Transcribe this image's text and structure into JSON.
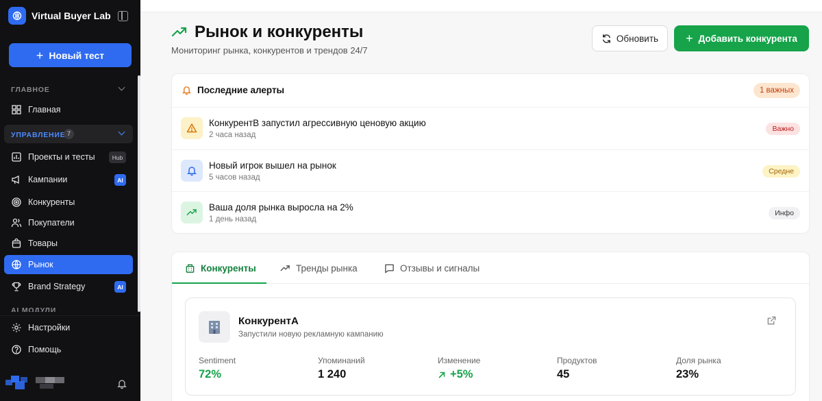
{
  "sidebar": {
    "brand": "Virtual Buyer Lab",
    "new_test": "Новый тест",
    "section_main": "ГЛАВНОЕ",
    "section_manage": "УПРАВЛЕНИЕ",
    "manage_count": "7",
    "section_ai": "AI МОДУЛИ",
    "items": [
      {
        "label": "Главная",
        "icon": "grid-icon"
      },
      {
        "label": "Проекты и тесты",
        "icon": "chart-icon",
        "tag": "Hub"
      },
      {
        "label": "Кампании",
        "icon": "megaphone-icon",
        "tag": "AI"
      },
      {
        "label": "Конкуренты",
        "icon": "target-icon"
      },
      {
        "label": "Покупатели",
        "icon": "users-icon"
      },
      {
        "label": "Товары",
        "icon": "bag-icon"
      },
      {
        "label": "Рынок",
        "icon": "globe-icon",
        "active": true
      },
      {
        "label": "Brand Strategy",
        "icon": "trophy-icon",
        "tag": "AI"
      }
    ],
    "settings": "Настройки",
    "help": "Помощь"
  },
  "header": {
    "title": "Рынок и конкуренты",
    "subtitle": "Мониторинг рынка, конкурентов и трендов 24/7",
    "refresh": "Обновить",
    "add": "Добавить конкурента"
  },
  "alerts": {
    "title": "Последние алерты",
    "important": "1 важных",
    "items": [
      {
        "title": "КонкурентВ запустил агрессивную ценовую акцию",
        "time": "2 часа назад",
        "badge": "Важно",
        "icon": "warning-icon"
      },
      {
        "title": "Новый игрок вышел на рынок",
        "time": "5 часов назад",
        "badge": "Средне",
        "icon": "bell-icon"
      },
      {
        "title": "Ваша доля рынка выросла на 2%",
        "time": "1 день назад",
        "badge": "Инфо",
        "icon": "trend-up-icon"
      }
    ]
  },
  "tabs": [
    {
      "label": "Конкуренты",
      "icon": "building-icon",
      "active": true
    },
    {
      "label": "Тренды рынка",
      "icon": "trend-up-icon"
    },
    {
      "label": "Отзывы и сигналы",
      "icon": "message-icon"
    }
  ],
  "competitor": {
    "name": "КонкурентА",
    "description": "Запустили новую рекламную кампанию",
    "stats": [
      {
        "label": "Sentiment",
        "value": "72%"
      },
      {
        "label": "Упоминаний",
        "value": "1 240"
      },
      {
        "label": "Изменение",
        "value": "+5%"
      },
      {
        "label": "Продуктов",
        "value": "45"
      },
      {
        "label": "Доля рынка",
        "value": "23%"
      }
    ]
  },
  "colors": {
    "accent_blue": "#2f6bf0",
    "accent_green": "#16a34a",
    "sidebar_bg": "#111113"
  }
}
